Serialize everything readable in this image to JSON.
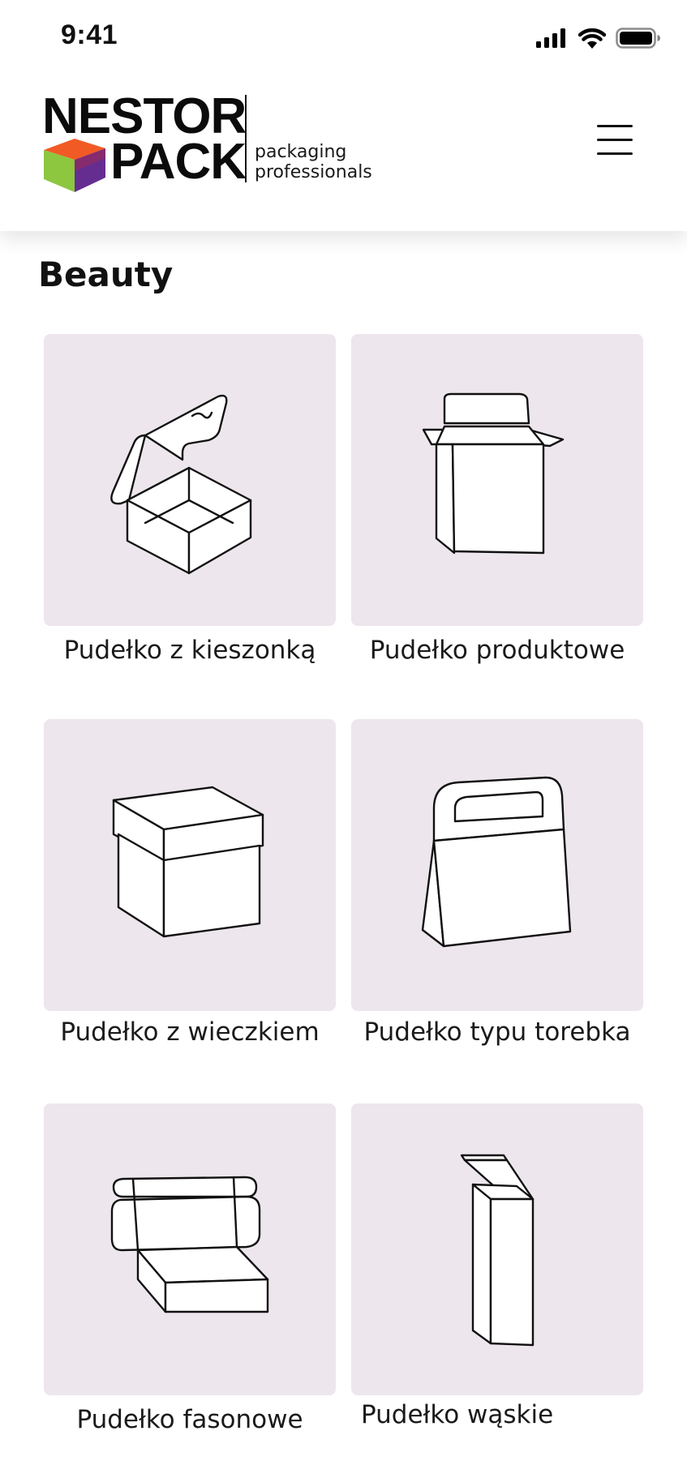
{
  "status_bar": {
    "time": "9:41",
    "icons": [
      "cellular-signal-icon",
      "wifi-icon",
      "battery-icon"
    ]
  },
  "brand": {
    "name_line1": "NESTOR",
    "name_line2": "PACK",
    "tagline_line1": "packaging",
    "tagline_line2": "professionals",
    "cube_colors": [
      "#f15a24",
      "#8dc63f",
      "#662d91"
    ]
  },
  "header": {
    "menu_icon": "hamburger-menu-icon"
  },
  "page": {
    "title": "Beauty",
    "tile_background": "#ede6ec"
  },
  "products": [
    {
      "label": "Pudełko z kieszonką",
      "icon": "pocket-box-icon"
    },
    {
      "label": "Pudełko  produktowe",
      "icon": "product-box-icon"
    },
    {
      "label": "Pudełko z wieczkiem",
      "icon": "lid-box-icon"
    },
    {
      "label": "Pudełko typu torebka",
      "icon": "bag-box-icon"
    },
    {
      "label": "Pudełko fasonowe",
      "icon": "mailer-box-icon"
    },
    {
      "label": "Pudełko wąskie",
      "icon": "narrow-box-icon"
    }
  ]
}
